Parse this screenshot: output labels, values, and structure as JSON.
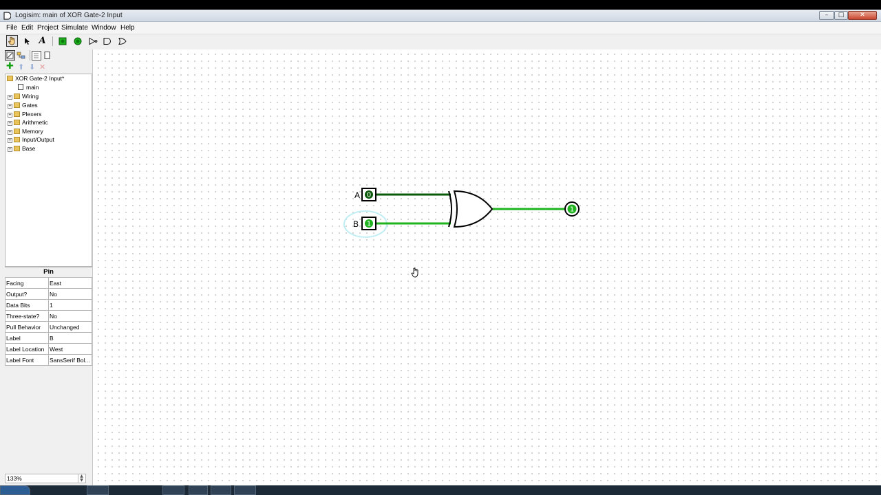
{
  "window": {
    "title": "Logisim: main of XOR Gate-2 Input",
    "controls": {
      "minimize": "–",
      "maximize": "□",
      "close": "✕"
    }
  },
  "menu": [
    "File",
    "Edit",
    "Project",
    "Simulate",
    "Window",
    "Help"
  ],
  "toolbar": {
    "tools": [
      "poke-tool",
      "select-tool",
      "text-tool",
      "add-pin-in-tool",
      "add-pin-out-tool",
      "not-gate-tool",
      "and-gate-tool",
      "or-gate-tool"
    ],
    "text_tool_glyph": "A"
  },
  "explorer": {
    "project": "XOR Gate-2 Input*",
    "circuit": "main",
    "libraries": [
      "Wiring",
      "Gates",
      "Plexers",
      "Arithmetic",
      "Memory",
      "Input/Output",
      "Base"
    ]
  },
  "attributes": {
    "title": "Pin",
    "rows": [
      {
        "key": "Facing",
        "value": "East"
      },
      {
        "key": "Output?",
        "value": "No"
      },
      {
        "key": "Data Bits",
        "value": "1"
      },
      {
        "key": "Three-state?",
        "value": "No"
      },
      {
        "key": "Pull Behavior",
        "value": "Unchanged"
      },
      {
        "key": "Label",
        "value": "B"
      },
      {
        "key": "Label Location",
        "value": "West"
      },
      {
        "key": "Label Font",
        "value": "SansSerif Bol..."
      }
    ]
  },
  "zoom": "133%",
  "circuit": {
    "input_a": {
      "label": "A",
      "value": "0"
    },
    "input_b": {
      "label": "B",
      "value": "1"
    },
    "output": {
      "value": "1"
    },
    "gate": "XOR",
    "colors": {
      "wire_low": "#0a5a0a",
      "wire_high": "#1fb31f",
      "selection": "#bfeef5"
    }
  }
}
